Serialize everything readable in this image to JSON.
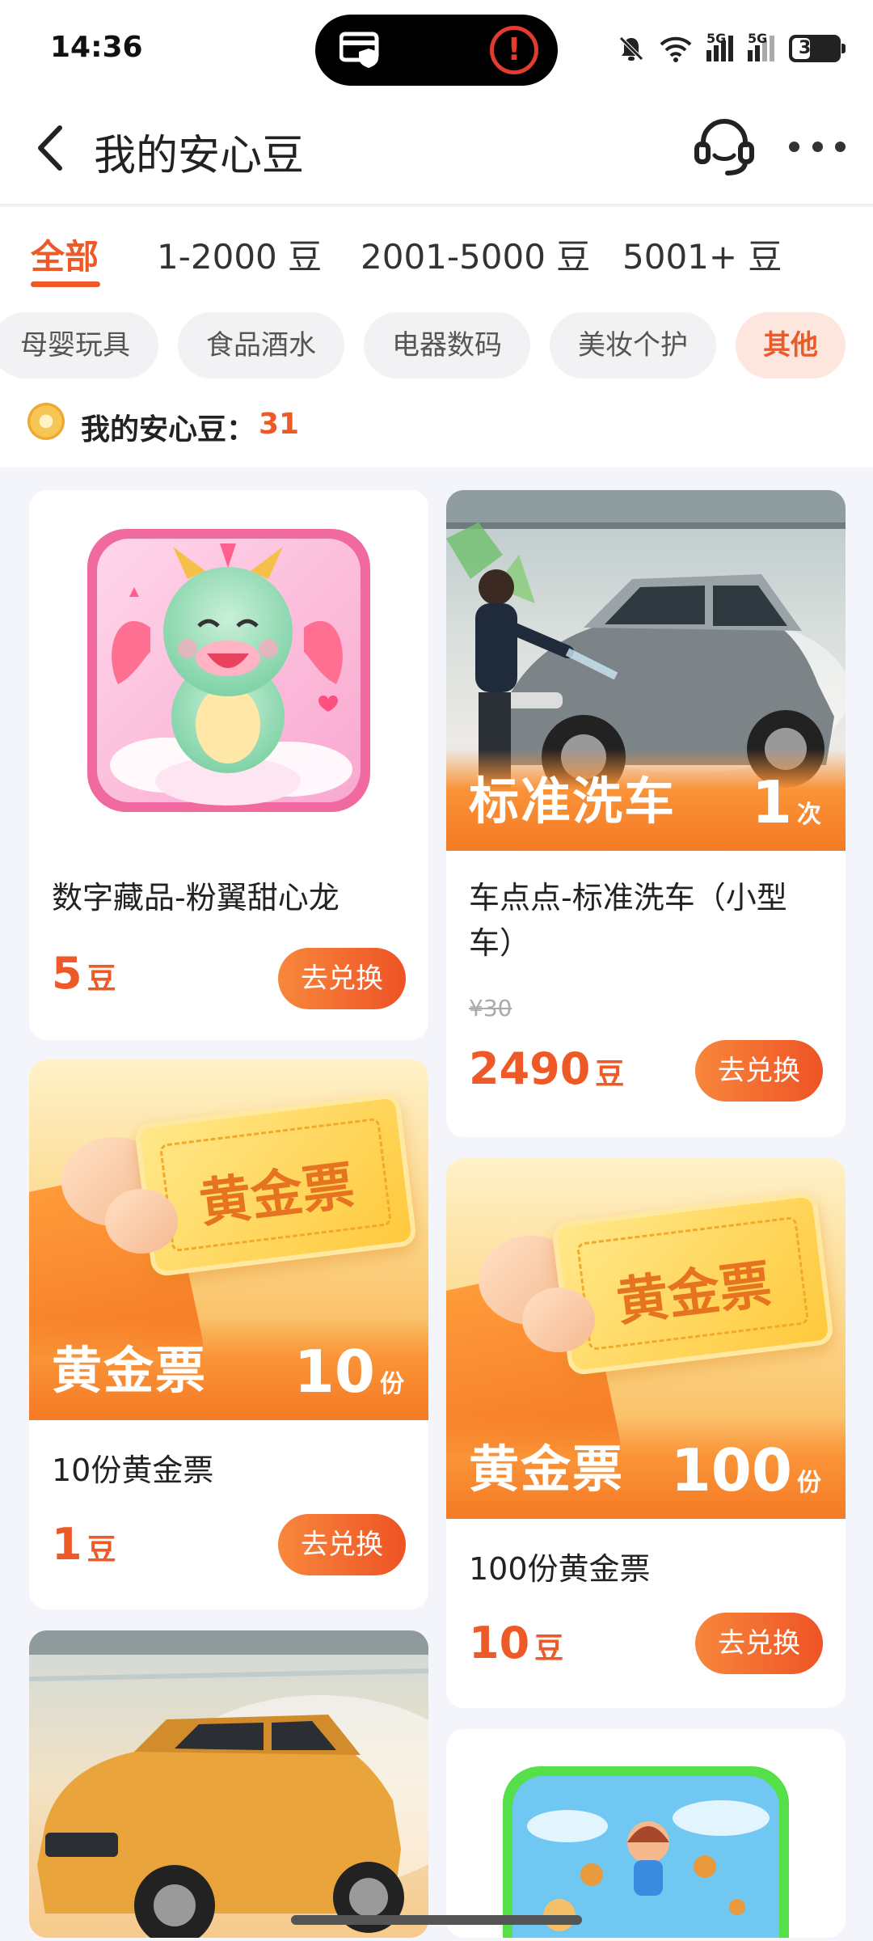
{
  "status_bar": {
    "time": "14:36",
    "battery": "36",
    "signal1": "5G",
    "signal2": "5G"
  },
  "header": {
    "title": "我的安心豆"
  },
  "tabs": [
    {
      "label": "全部"
    },
    {
      "label": "1-2000 豆"
    },
    {
      "label": "2001-5000 豆"
    },
    {
      "label": "5001+ 豆"
    }
  ],
  "chips": [
    {
      "label": "母婴玩具"
    },
    {
      "label": "食品酒水"
    },
    {
      "label": "电器数码"
    },
    {
      "label": "美妆个护"
    },
    {
      "label": "其他"
    }
  ],
  "balance": {
    "label": "我的安心豆：",
    "value": "31"
  },
  "products": [
    {
      "title": "数字藏品-粉翼甜心龙",
      "price": "5",
      "unit": "豆",
      "button": "去兑换"
    },
    {
      "title": "车点点-标准洗车（小型车）",
      "original_price": "¥30",
      "price": "2490",
      "unit": "豆",
      "button": "去兑换",
      "banner_text": "标准洗车",
      "banner_num": "1",
      "banner_unit": "次"
    },
    {
      "title": "10份黄金票",
      "price": "1",
      "unit": "豆",
      "button": "去兑换",
      "banner_text": "黄金票",
      "banner_num": "10",
      "banner_unit": "份",
      "ticket_text": "黄金票"
    },
    {
      "title": "100份黄金票",
      "price": "10",
      "unit": "豆",
      "button": "去兑换",
      "banner_text": "黄金票",
      "banner_num": "100",
      "banner_unit": "份",
      "ticket_text": "黄金票"
    }
  ],
  "colors": {
    "accent": "#ee5a27",
    "background": "#f4f5fb",
    "button_gradient_start": "#f8873c",
    "button_gradient_end": "#ee5325"
  }
}
